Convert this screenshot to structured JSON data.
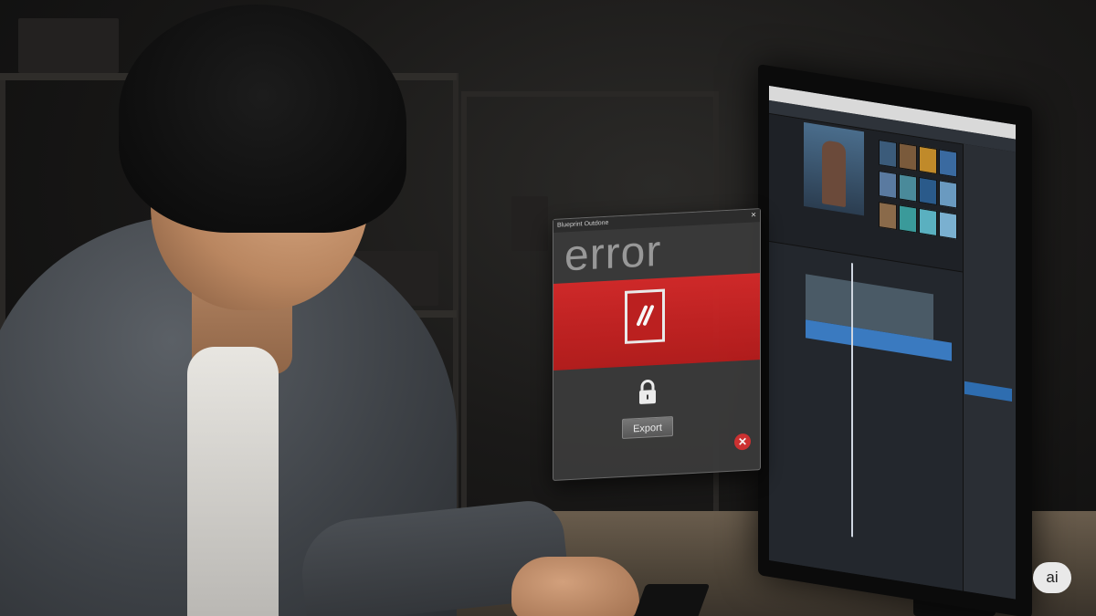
{
  "dialog": {
    "title": "Blueprint Outdone",
    "close_glyph": "×",
    "heading": "error",
    "export_label": "Export",
    "error_glyph": "✕",
    "colors": {
      "banner": "#c82222",
      "body": "#3a3a3a",
      "error_icon": "#d23232"
    }
  },
  "watermark": {
    "label": "ai"
  },
  "icons": [
    "close-icon",
    "no-entry-icon",
    "lock-icon",
    "error-circle-icon"
  ]
}
